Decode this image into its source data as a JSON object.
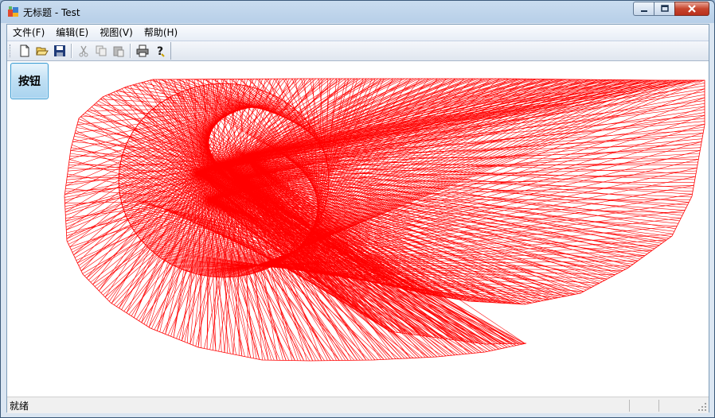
{
  "window": {
    "title": "无标题 - Test"
  },
  "menu": [
    {
      "label": "文件(F)"
    },
    {
      "label": "编辑(E)"
    },
    {
      "label": "视图(V)"
    },
    {
      "label": "帮助(H)"
    }
  ],
  "toolbar": {
    "buttons": [
      {
        "icon": "new-icon"
      },
      {
        "icon": "open-icon"
      },
      {
        "icon": "save-icon"
      },
      {
        "icon": "cut-icon"
      },
      {
        "icon": "copy-icon"
      },
      {
        "icon": "paste-icon"
      },
      {
        "icon": "print-icon"
      },
      {
        "icon": "help-icon"
      }
    ]
  },
  "content": {
    "button_label": "按钮",
    "line_color": "#ff0000"
  },
  "status": {
    "text": "就绪"
  }
}
